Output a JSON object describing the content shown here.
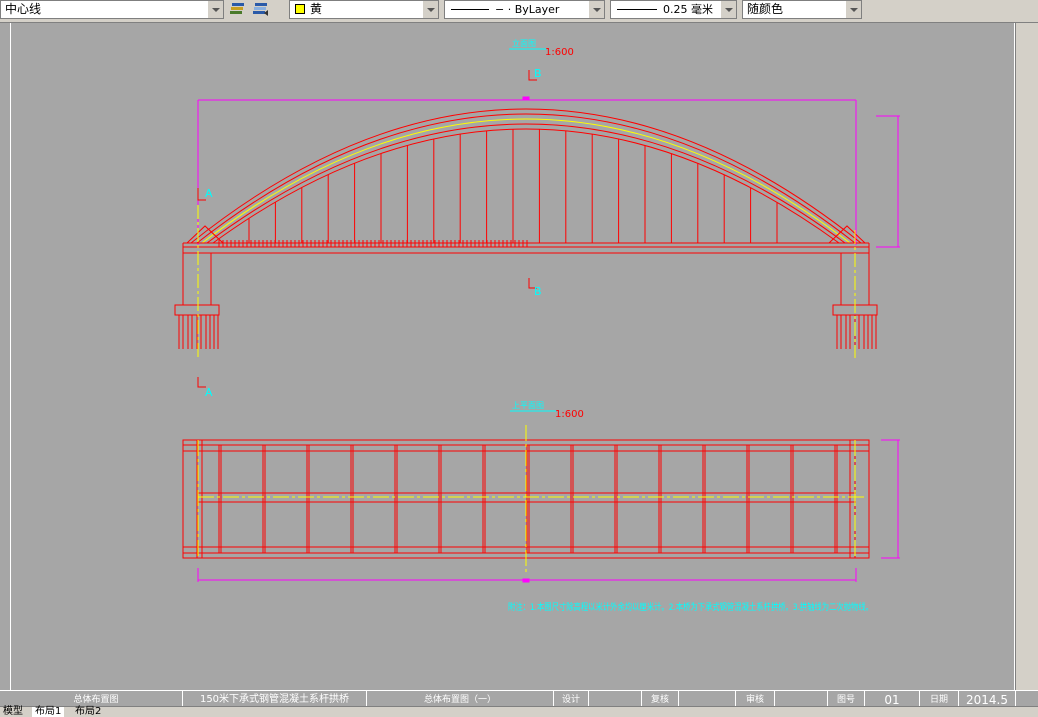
{
  "toolbar": {
    "layer_combo": "中心线",
    "color_combo": "黄",
    "linetype_combo": "ByLayer",
    "lineweight_combo": "0.25 毫米",
    "plotstyle_combo": "随颜色"
  },
  "drawing": {
    "elevation_scale": "1:600",
    "plan_scale": "1:600",
    "section_a_top": "A",
    "section_a_bottom": "A",
    "section_b_top": "B",
    "section_b_bottom": "B"
  },
  "title_block": {
    "cell_1": "总体布置图",
    "cell_2": "150米下承式钢管混凝土系杆拱桥",
    "cell_3": "总体布置图（一）",
    "cell_4": "设计",
    "cell_5": "复核",
    "cell_6": "审核",
    "cell_7": "图号",
    "cell_8": "01",
    "cell_9": "日期",
    "cell_10": "2014.5"
  },
  "tabs": {
    "model": "模型",
    "layout1": "布局1",
    "layout2": "布局2"
  },
  "colors": {
    "canvas": "#a6a6a6",
    "structure": "#ff0000",
    "dimension": "#ff00ff",
    "annotation": "#00ffff",
    "centerline": "#ffff00"
  }
}
